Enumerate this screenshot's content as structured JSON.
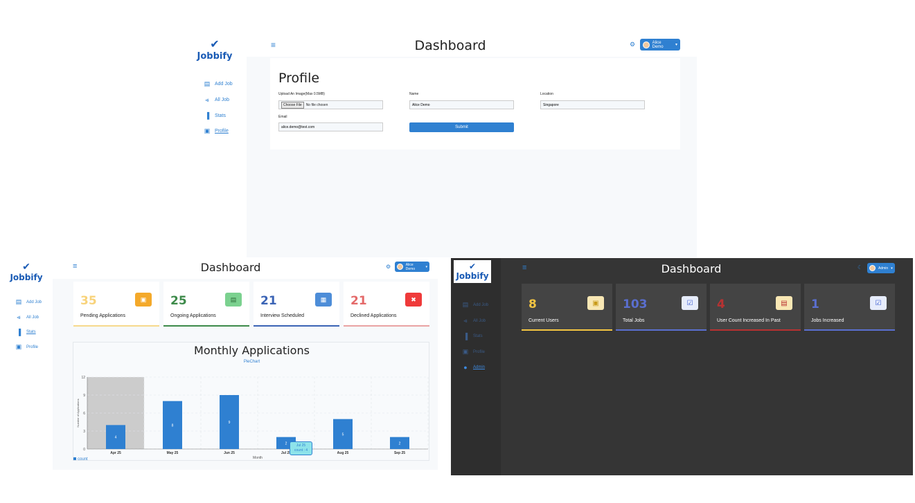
{
  "brand": {
    "name": "Jobbify"
  },
  "colors": {
    "primary": "#2f80d1",
    "pending": "#f4a92a",
    "ongoing": "#3d8a4a",
    "interview": "#3b64b5",
    "declined": "#e46a6a",
    "dark_bg": "#353535",
    "dark_sidebar": "#2e2e2e"
  },
  "profile_screen": {
    "header_title": "Dashboard",
    "user_button": "Alice Demo",
    "nav": [
      "Add Job",
      "All Job",
      "Stats",
      "Profile"
    ],
    "heading": "Profile",
    "fields": {
      "upload_label": "Upload An Image(Max 0.5MB)",
      "choose_file": "Choose File",
      "no_file": "No file chosen",
      "name_label": "Name",
      "name_value": "Alice Demo",
      "location_label": "Location",
      "location_value": "Singapore",
      "email_label": "Email",
      "email_value": "alice.demo@test.com",
      "submit": "Submit"
    }
  },
  "stats_screen": {
    "header_title": "Dashboard",
    "user_button": "Alice Demo",
    "nav": [
      "Add Job",
      "All Job",
      "Stats",
      "Profile"
    ],
    "cards": [
      {
        "count": "35",
        "label": "Pending Applications"
      },
      {
        "count": "25",
        "label": "Ongoing Applications"
      },
      {
        "count": "21",
        "label": "Interview Scheduled"
      },
      {
        "count": "21",
        "label": "Declined Applications"
      }
    ],
    "chart_title": "Monthly Applications",
    "chart_toggle": "PieChart",
    "tooltip": {
      "title": "Jul 25",
      "line": "count : 4"
    }
  },
  "admin_screen": {
    "header_title": "Dashboard",
    "user_button": "Admin",
    "nav": [
      "Add Job",
      "All Job",
      "Stats",
      "Profile",
      "Admin"
    ],
    "cards": [
      {
        "count": "8",
        "label": "Current Users"
      },
      {
        "count": "103",
        "label": "Total Jobs"
      },
      {
        "count": "4",
        "label": "User Count Increased In Past"
      },
      {
        "count": "1",
        "label": "Jobs Increased"
      }
    ]
  },
  "chart_data": {
    "type": "bar",
    "title": "",
    "categories": [
      "Apr 25",
      "May 25",
      "Jun 25",
      "Jul 25",
      "Aug 25",
      "Sep 25"
    ],
    "series": [
      {
        "name": "count",
        "values": [
          4,
          8,
          9,
          2,
          5,
          2
        ]
      }
    ],
    "xlabel": "Month",
    "ylabel": "Number of Applications",
    "ylim": [
      0,
      12
    ],
    "yticks": [
      "0",
      "3",
      "6",
      "9",
      "12"
    ],
    "grid": true,
    "legend": "bottom-left",
    "highlighted_category": "Apr 25"
  }
}
